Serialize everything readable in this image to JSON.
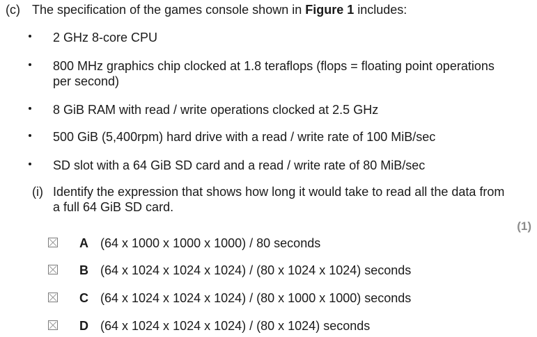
{
  "part": {
    "label": "(c)",
    "stem_before": "The specification of the games console shown in ",
    "stem_bold": "Figure 1",
    "stem_after": " includes:"
  },
  "specs": [
    "2 GHz 8-core CPU",
    "800 MHz graphics chip clocked at 1.8 teraflops (flops = floating point operations per second)",
    "8 GiB RAM with read / write operations clocked at 2.5 GHz",
    "500 GiB (5,400rpm) hard drive with a read / write rate of 100 MiB/sec",
    "SD slot with a 64 GiB SD card and a read / write rate of 80 MiB/sec"
  ],
  "sub_question": {
    "label": "(i)",
    "text": "Identify the expression that shows how long it would take to read all the data from a full 64 GiB SD card.",
    "marks": "(1)"
  },
  "options": [
    {
      "letter": "A",
      "text": "(64 x 1000 x 1000 x 1000) / 80 seconds"
    },
    {
      "letter": "B",
      "text": "(64 x 1024 x 1024 x 1024) / (80 x 1024 x 1024) seconds"
    },
    {
      "letter": "C",
      "text": "(64 x 1024 x 1024 x 1024) / (80 x 1000 x 1000) seconds"
    },
    {
      "letter": "D",
      "text": "(64 x 1024 x 1024 x 1024) / (80 x 1024) seconds"
    }
  ]
}
